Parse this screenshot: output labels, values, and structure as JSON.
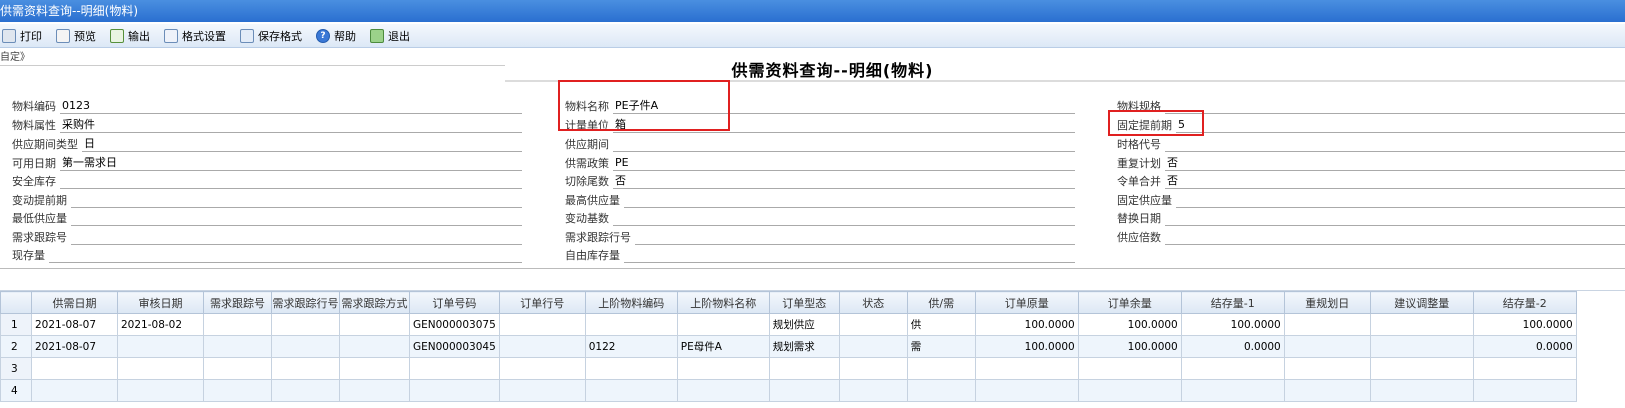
{
  "window": {
    "title": "供需资料查询--明细(物料)"
  },
  "toolbar": {
    "print": "打印",
    "preview": "预览",
    "output": "输出",
    "format_settings": "格式设置",
    "save_format": "保存格式",
    "help": "帮助",
    "exit": "退出"
  },
  "custom_label": "自定》",
  "page_title": "供需资料查询--明细(物料)",
  "fields": {
    "item_code": {
      "label": "物料编码",
      "value": "0123"
    },
    "item_attr": {
      "label": "物料属性",
      "value": "采购件"
    },
    "supply_period_type": {
      "label": "供应期间类型",
      "value": "日"
    },
    "available_date": {
      "label": "可用日期",
      "value": "第一需求日"
    },
    "safety_stock": {
      "label": "安全库存",
      "value": ""
    },
    "variable_lead": {
      "label": "变动提前期",
      "value": ""
    },
    "min_supply": {
      "label": "最低供应量",
      "value": ""
    },
    "demand_track_no": {
      "label": "需求跟踪号",
      "value": ""
    },
    "on_hand": {
      "label": "现存量",
      "value": ""
    },
    "item_name": {
      "label": "物料名称",
      "value": "PE子件A"
    },
    "uom": {
      "label": "计量单位",
      "value": "箱"
    },
    "supply_period": {
      "label": "供应期间",
      "value": ""
    },
    "supply_policy": {
      "label": "供需政策",
      "value": "PE"
    },
    "cut_tail": {
      "label": "切除尾数",
      "value": "否"
    },
    "max_supply": {
      "label": "最高供应量",
      "value": ""
    },
    "variable_base": {
      "label": "变动基数",
      "value": ""
    },
    "demand_track_line": {
      "label": "需求跟踪行号",
      "value": ""
    },
    "free_stock": {
      "label": "自由库存量",
      "value": ""
    },
    "item_spec": {
      "label": "物料规格",
      "value": ""
    },
    "fixed_lead": {
      "label": "固定提前期",
      "value": "5"
    },
    "time_code": {
      "label": "时格代号",
      "value": ""
    },
    "repeat_plan": {
      "label": "重复计划",
      "value": "否"
    },
    "order_merge": {
      "label": "令单合并",
      "value": "否"
    },
    "fixed_supply": {
      "label": "固定供应量",
      "value": ""
    },
    "replace_date": {
      "label": "替换日期",
      "value": ""
    },
    "supply_multiple": {
      "label": "供应倍数",
      "value": ""
    }
  },
  "grid": {
    "columns": [
      "",
      "供需日期",
      "审核日期",
      "需求跟踪号",
      "需求跟踪行号",
      "需求跟踪方式",
      "订单号码",
      "订单行号",
      "上阶物料编码",
      "上阶物料名称",
      "订单型态",
      "状态",
      "供/需",
      "订单原量",
      "订单余量",
      "结存量-1",
      "重规划日",
      "建议调整量",
      "结存量-2"
    ],
    "rows": [
      [
        "1",
        "2021-08-07",
        "2021-08-02",
        "",
        "",
        "",
        "GEN000003075",
        "",
        "",
        "",
        "规划供应",
        "",
        "供",
        "100.0000",
        "100.0000",
        "100.0000",
        "",
        "",
        "100.0000"
      ],
      [
        "2",
        "2021-08-07",
        "",
        "",
        "",
        "",
        "GEN000003045",
        "",
        "0122",
        "PE母件A",
        "规划需求",
        "",
        "需",
        "100.0000",
        "100.0000",
        "0.0000",
        "",
        "",
        "0.0000"
      ],
      [
        "3",
        "",
        "",
        "",
        "",
        "",
        "",
        "",
        "",
        "",
        "",
        "",
        "",
        "",
        "",
        "",
        "",
        "",
        ""
      ],
      [
        "4",
        "",
        "",
        "",
        "",
        "",
        "",
        "",
        "",
        "",
        "",
        "",
        "",
        "",
        "",
        "",
        "",
        "",
        ""
      ]
    ]
  }
}
